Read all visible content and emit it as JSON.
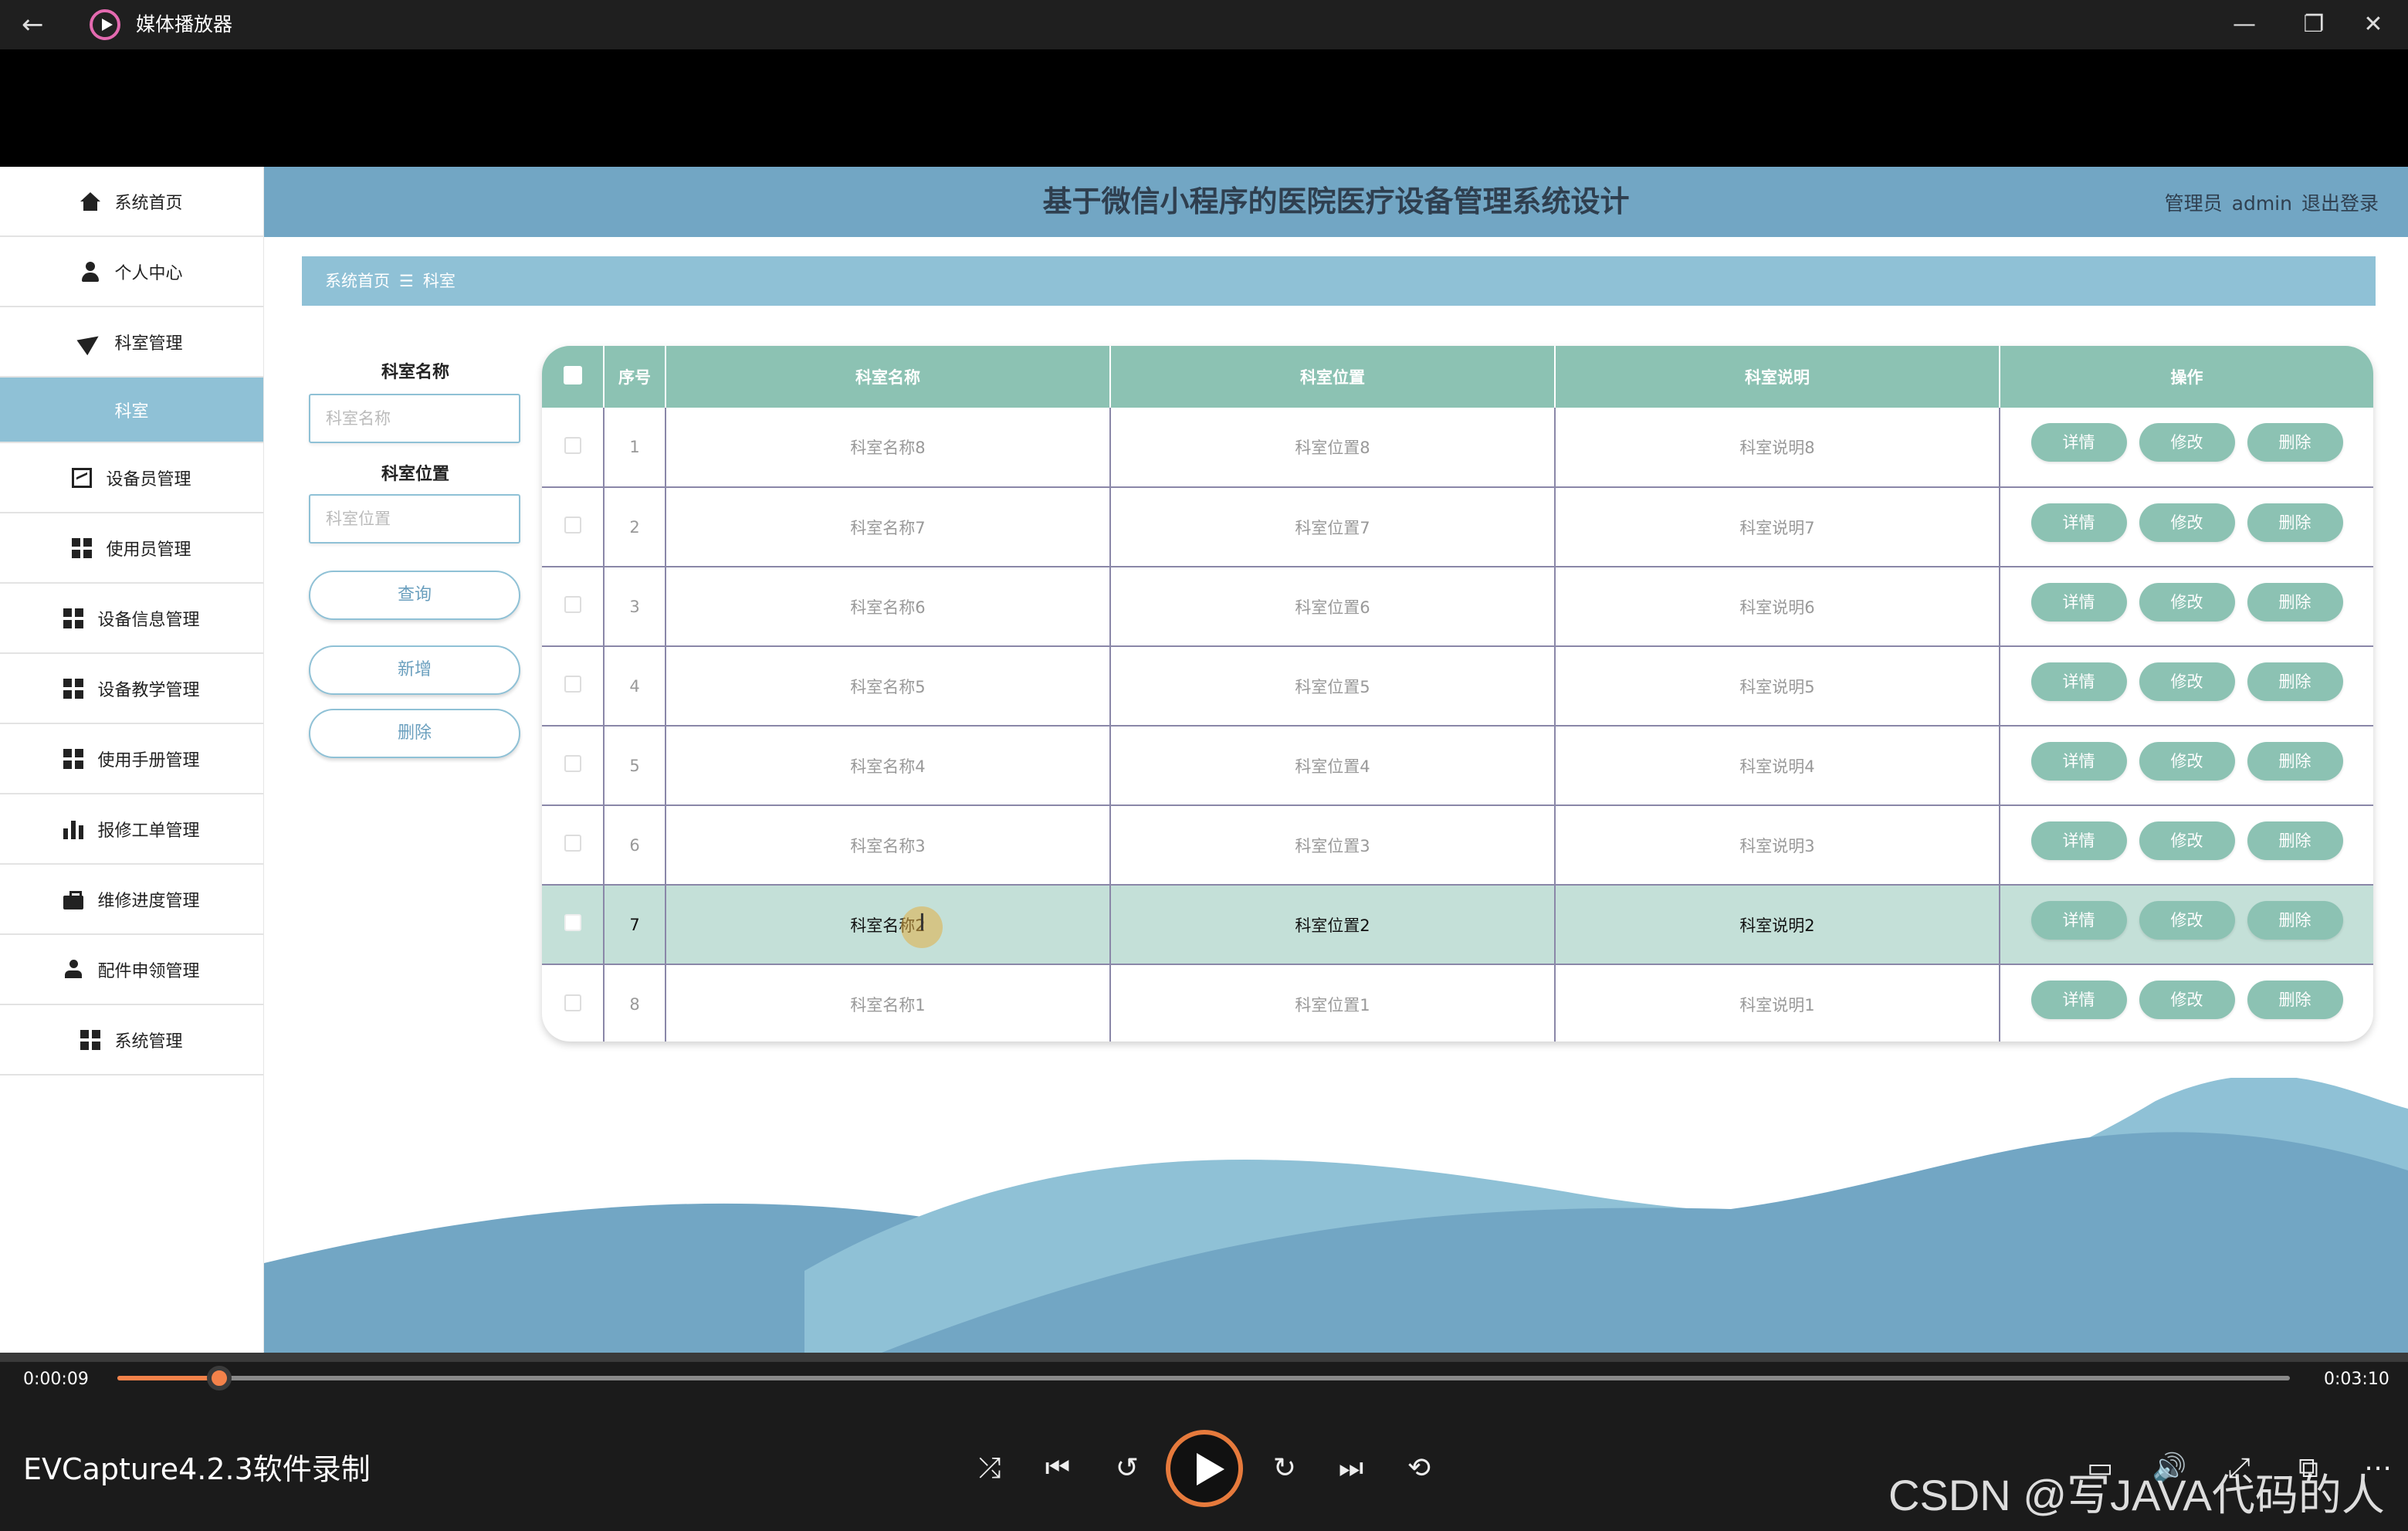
{
  "window": {
    "title": "媒体播放器",
    "back_glyph": "←",
    "minimize_glyph": "—",
    "maximize_glyph": "❐",
    "close_glyph": "✕"
  },
  "header": {
    "title": "基于微信小程序的医院医疗设备管理系统设计",
    "user_role": "管理员",
    "username": "admin",
    "logout": "退出登录"
  },
  "breadcrumb": {
    "home": "系统首页",
    "separator": "☰",
    "current": "科室"
  },
  "sidebar": {
    "items": [
      {
        "label": "系统首页",
        "icon": "home-icon"
      },
      {
        "label": "个人中心",
        "icon": "user-icon"
      },
      {
        "label": "科室管理",
        "icon": "send-icon"
      },
      {
        "label": "科室",
        "icon": "",
        "active": true
      },
      {
        "label": "设备员管理",
        "icon": "chart-icon"
      },
      {
        "label": "使用员管理",
        "icon": "grid-icon"
      },
      {
        "label": "设备信息管理",
        "icon": "grid-icon"
      },
      {
        "label": "设备教学管理",
        "icon": "grid-icon"
      },
      {
        "label": "使用手册管理",
        "icon": "grid-icon"
      },
      {
        "label": "报修工单管理",
        "icon": "bar-chart-icon"
      },
      {
        "label": "维修进度管理",
        "icon": "briefcase-icon"
      },
      {
        "label": "配件申领管理",
        "icon": "person-icon"
      },
      {
        "label": "系统管理",
        "icon": "grid-icon"
      }
    ]
  },
  "search": {
    "name_label": "科室名称",
    "name_placeholder": "科室名称",
    "location_label": "科室位置",
    "location_placeholder": "科室位置",
    "query_button": "查询",
    "add_button": "新增",
    "delete_button": "删除"
  },
  "table": {
    "columns": [
      "序号",
      "科室名称",
      "科室位置",
      "科室说明",
      "操作"
    ],
    "actions": {
      "detail": "详情",
      "edit": "修改",
      "delete": "删除"
    },
    "rows": [
      {
        "index": "1",
        "name": "科室名称8",
        "location": "科室位置8",
        "desc": "科室说明8"
      },
      {
        "index": "2",
        "name": "科室名称7",
        "location": "科室位置7",
        "desc": "科室说明7"
      },
      {
        "index": "3",
        "name": "科室名称6",
        "location": "科室位置6",
        "desc": "科室说明6"
      },
      {
        "index": "4",
        "name": "科室名称5",
        "location": "科室位置5",
        "desc": "科室说明5"
      },
      {
        "index": "5",
        "name": "科室名称4",
        "location": "科室位置4",
        "desc": "科室说明4"
      },
      {
        "index": "6",
        "name": "科室名称3",
        "location": "科室位置3",
        "desc": "科室说明3"
      },
      {
        "index": "7",
        "name": "科室名称2",
        "location": "科室位置2",
        "desc": "科室说明2",
        "highlighted": true
      },
      {
        "index": "8",
        "name": "科室名称1",
        "location": "科室位置1",
        "desc": "科室说明1"
      }
    ]
  },
  "player": {
    "current_time": "0:00:09",
    "total_time": "0:03:10",
    "progress": 0.047,
    "recorder_label": "EVCapture4.2.3软件录制",
    "watermark": "CSDN @写JAVA代码的人"
  },
  "colors": {
    "accent_blue": "#72a6c4",
    "light_blue": "#8fc1d6",
    "table_green": "#8cc2b3",
    "highlight_row": "#c4e0d8",
    "progress_orange": "#f4824a"
  }
}
